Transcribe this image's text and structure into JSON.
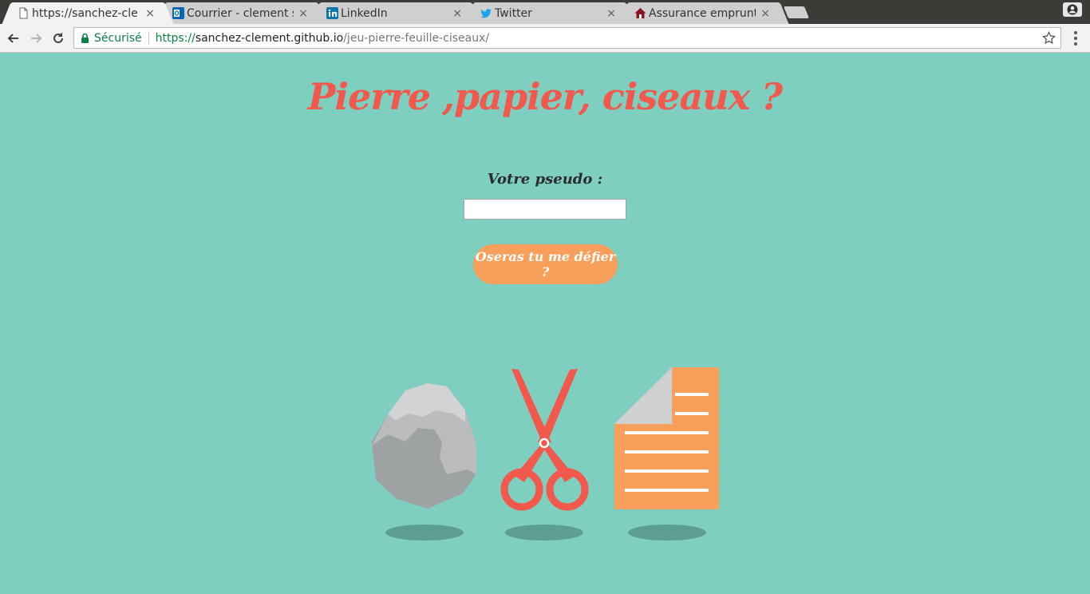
{
  "browser": {
    "tabs": [
      {
        "label": "https://sanchez-cle",
        "icon": "document-icon",
        "active": true
      },
      {
        "label": "Courrier - clement s",
        "icon": "outlook-icon"
      },
      {
        "label": "LinkedIn",
        "icon": "linkedin-icon"
      },
      {
        "label": "Twitter",
        "icon": "twitter-icon"
      },
      {
        "label": "Assurance emprunt",
        "icon": "house-icon"
      }
    ],
    "close_glyph": "×",
    "secure_label": "Sécurisé",
    "url": {
      "scheme": "https://",
      "host": "sanchez-clement.github.io",
      "path": "/jeu-pierre-feuille-ciseaux/"
    }
  },
  "page": {
    "title": "Pierre ,papier, ciseaux ?",
    "pseudo_label": "Votre pseudo :",
    "pseudo_value": "",
    "challenge_button": "Oseras tu me défier ?",
    "images": [
      "rock-image",
      "scissors-image",
      "paper-image"
    ]
  },
  "colors": {
    "background": "#7ecfbf",
    "title": "#f2584c",
    "button": "#f79f5b",
    "shadow": "#5e9e91"
  }
}
